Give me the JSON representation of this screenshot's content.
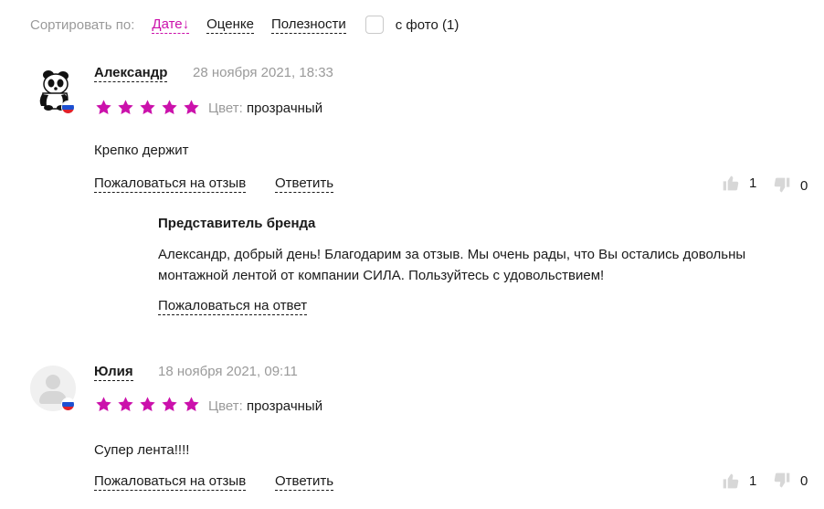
{
  "sort": {
    "label": "Сортировать по:",
    "options": [
      "Дате↓",
      "Оценке",
      "Полезности"
    ],
    "active_index": 0,
    "photo_filter": "с фото (1)",
    "photo_checked": false
  },
  "colors": {
    "accent": "#cb11ab",
    "muted": "#9a9a9a",
    "text": "#1a1a1a"
  },
  "reviews": [
    {
      "author": "Александр",
      "date": "28 ноября 2021, 18:33",
      "rating": 5,
      "color_label": "Цвет:",
      "color_value": "прозрачный",
      "text": "Крепко держит",
      "complain": "Пожаловаться на отзыв",
      "reply": "Ответить",
      "likes": "1",
      "dislikes": "0",
      "avatar": "panda-avatar",
      "brand_reply": {
        "title": "Представитель бренда",
        "line1": "Александр, добрый день! Благодарим за отзыв. Мы очень рады, что Вы остались довольны",
        "line2": "монтажной лентой от компании СИЛА. Пользуйтесь с удовольствием!",
        "complain": "Пожаловаться на ответ"
      }
    },
    {
      "author": "Юлия",
      "date": "18 ноября 2021, 09:11",
      "rating": 5,
      "color_label": "Цвет:",
      "color_value": "прозрачный",
      "text": "Супер лента!!!!",
      "complain": "Пожаловаться на отзыв",
      "reply": "Ответить",
      "likes": "1",
      "dislikes": "0",
      "avatar": "default-avatar"
    }
  ]
}
